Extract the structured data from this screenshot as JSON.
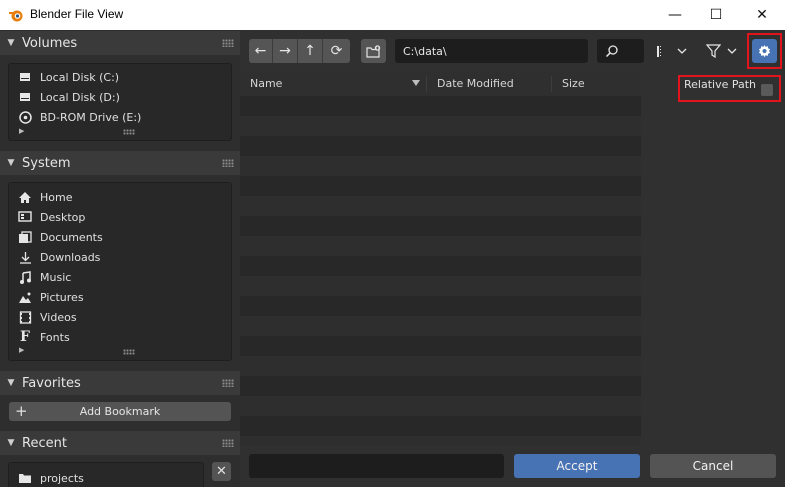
{
  "window": {
    "title": "Blender File View",
    "minimize_glyph": "—",
    "maximize_glyph": "☐",
    "close_glyph": "✕"
  },
  "sidebar": {
    "volumes": {
      "header": "Volumes",
      "items": [
        {
          "label": "Local Disk (C:)",
          "icon": "disk-icon"
        },
        {
          "label": "Local Disk (D:)",
          "icon": "disk-icon"
        },
        {
          "label": "BD-ROM Drive (E:)",
          "icon": "disc-icon"
        }
      ]
    },
    "system": {
      "header": "System",
      "items": [
        {
          "label": "Home",
          "icon": "home-icon"
        },
        {
          "label": "Desktop",
          "icon": "desktop-icon"
        },
        {
          "label": "Documents",
          "icon": "documents-icon"
        },
        {
          "label": "Downloads",
          "icon": "download-icon"
        },
        {
          "label": "Music",
          "icon": "music-icon"
        },
        {
          "label": "Pictures",
          "icon": "pictures-icon"
        },
        {
          "label": "Videos",
          "icon": "videos-icon"
        },
        {
          "label": "Fonts",
          "icon": "font-icon"
        }
      ]
    },
    "favorites": {
      "header": "Favorites",
      "add_bookmark_label": "Add Bookmark"
    },
    "recent": {
      "header": "Recent",
      "items": [
        {
          "label": "projects",
          "icon": "folder-icon"
        }
      ]
    }
  },
  "toolbar": {
    "path_value": "C:\\data\\",
    "search_value": ""
  },
  "file_list": {
    "columns": [
      "Name",
      "Date Modified",
      "Size"
    ],
    "rows": []
  },
  "options": {
    "relative_path_label": "Relative Path",
    "relative_path_checked": false
  },
  "bottom": {
    "filename_value": "",
    "accept_label": "Accept",
    "cancel_label": "Cancel"
  },
  "colors": {
    "accent": "#4772b3",
    "highlight": "#e0141a"
  }
}
